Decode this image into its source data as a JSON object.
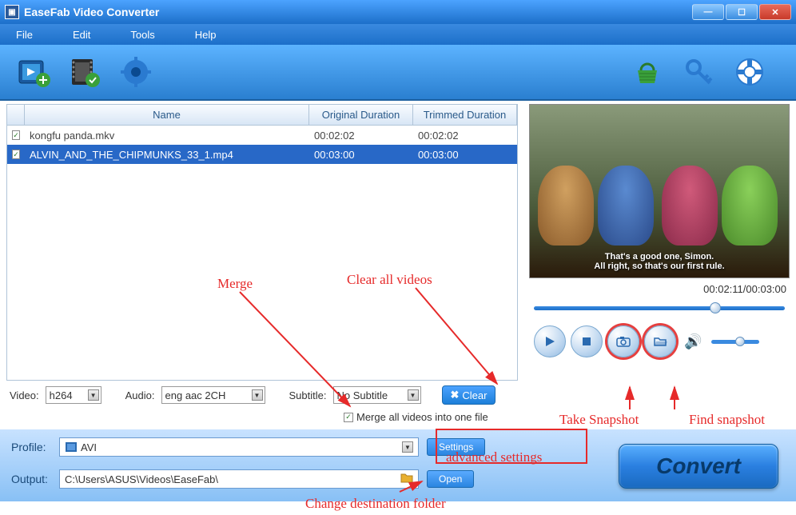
{
  "window": {
    "title": "EaseFab Video Converter"
  },
  "menu": {
    "file": "File",
    "edit": "Edit",
    "tools": "Tools",
    "help": "Help"
  },
  "filelist": {
    "headers": {
      "name": "Name",
      "orig": "Original Duration",
      "trim": "Trimmed Duration"
    },
    "rows": [
      {
        "checked": true,
        "name": "kongfu panda.mkv",
        "orig": "00:02:02",
        "trim": "00:02:02",
        "selected": false
      },
      {
        "checked": true,
        "name": "ALVIN_AND_THE_CHIPMUNKS_33_1.mp4",
        "orig": "00:03:00",
        "trim": "00:03:00",
        "selected": true
      }
    ]
  },
  "preview": {
    "subtitle_line1": "That's a good one, Simon.",
    "subtitle_line2": "All right, so that's our first rule.",
    "time": "00:02:11/00:03:00"
  },
  "format": {
    "video_label": "Video:",
    "video_value": "h264",
    "audio_label": "Audio:",
    "audio_value": "eng aac 2CH",
    "subtitle_label": "Subtitle:",
    "subtitle_value": "No Subtitle",
    "clear": "Clear",
    "merge": "Merge all videos into one file"
  },
  "bottom": {
    "profile_label": "Profile:",
    "profile_value": "AVI",
    "settings": "Settings",
    "output_label": "Output:",
    "output_value": "C:\\Users\\ASUS\\Videos\\EaseFab\\",
    "open": "Open",
    "convert": "Convert"
  },
  "annotations": {
    "merge": "Merge",
    "clear": "Clear all videos",
    "advanced": "advanced settings",
    "changedest": "Change destination folder",
    "snapshot": "Take Snapshot",
    "findsnap": "Find snapshot"
  }
}
